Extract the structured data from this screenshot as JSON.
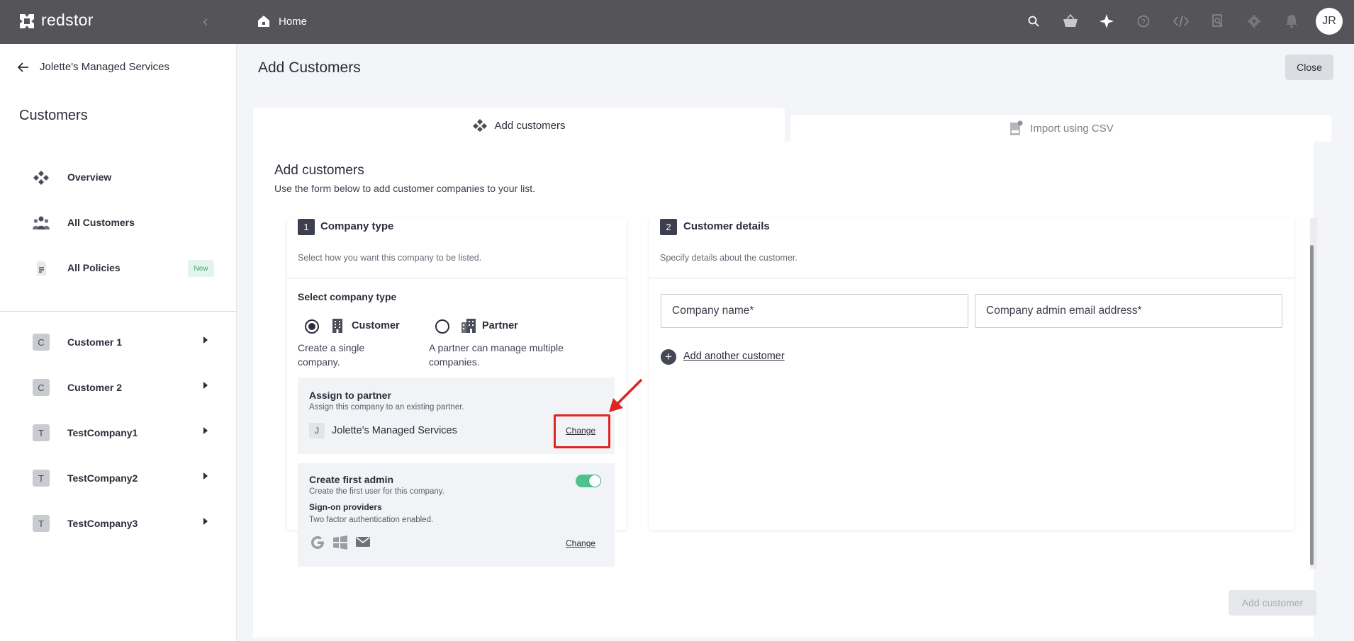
{
  "app": {
    "name": "redstor"
  },
  "topbar": {
    "breadcrumb": "Home",
    "avatar_initials": "JR",
    "icons": [
      "search-icon",
      "basket-icon",
      "sparkle-icon",
      "help-icon",
      "code-icon",
      "search-doc-icon",
      "gear-icon",
      "bell-icon"
    ]
  },
  "sidebar": {
    "back_label": "Jolette's Managed Services",
    "title": "Customers",
    "nav": [
      {
        "label": "Overview",
        "icon": "overview-icon"
      },
      {
        "label": "All Customers",
        "icon": "people-icon"
      },
      {
        "label": "All Policies",
        "icon": "document-icon",
        "badge": "New"
      }
    ],
    "customers": [
      {
        "initial": "C",
        "label": "Customer 1"
      },
      {
        "initial": "C",
        "label": "Customer 2"
      },
      {
        "initial": "T",
        "label": "TestCompany1"
      },
      {
        "initial": "T",
        "label": "TestCompany2"
      },
      {
        "initial": "T",
        "label": "TestCompany3"
      }
    ]
  },
  "main": {
    "title": "Add Customers",
    "close_label": "Close",
    "tabs": [
      {
        "label": "Add customers",
        "active": true
      },
      {
        "label": "Import using CSV",
        "active": false
      }
    ],
    "panel": {
      "title": "Add customers",
      "subtitle": "Use the form below to add customer companies to your list."
    },
    "step1": {
      "number": "1",
      "title": "Company type",
      "subtitle": "Select how you want this company to be listed.",
      "select_label": "Select company type",
      "options": [
        {
          "label": "Customer",
          "desc": "Create a single company.",
          "selected": true
        },
        {
          "label": "Partner",
          "desc": "A partner can manage multiple companies.",
          "selected": false
        }
      ],
      "assign": {
        "title": "Assign to partner",
        "subtitle": "Assign this company to an existing partner.",
        "partner_initial": "J",
        "partner_name": "Jolette's Managed Services",
        "change_label": "Change"
      },
      "admin": {
        "title": "Create first admin",
        "subtitle": "Create the first user for this company.",
        "enabled": true,
        "providers_title": "Sign-on providers",
        "providers_sub": "Two factor authentication enabled.",
        "change_label": "Change"
      }
    },
    "step2": {
      "number": "2",
      "title": "Customer details",
      "subtitle": "Specify details about the customer.",
      "company_name_placeholder": "Company name*",
      "email_placeholder": "Company admin email address*",
      "add_another_label": "Add another customer"
    },
    "submit_label": "Add customer"
  },
  "colors": {
    "topbar": "#555559",
    "accent_toggle": "#4cc38a",
    "highlight": "#e02424"
  }
}
